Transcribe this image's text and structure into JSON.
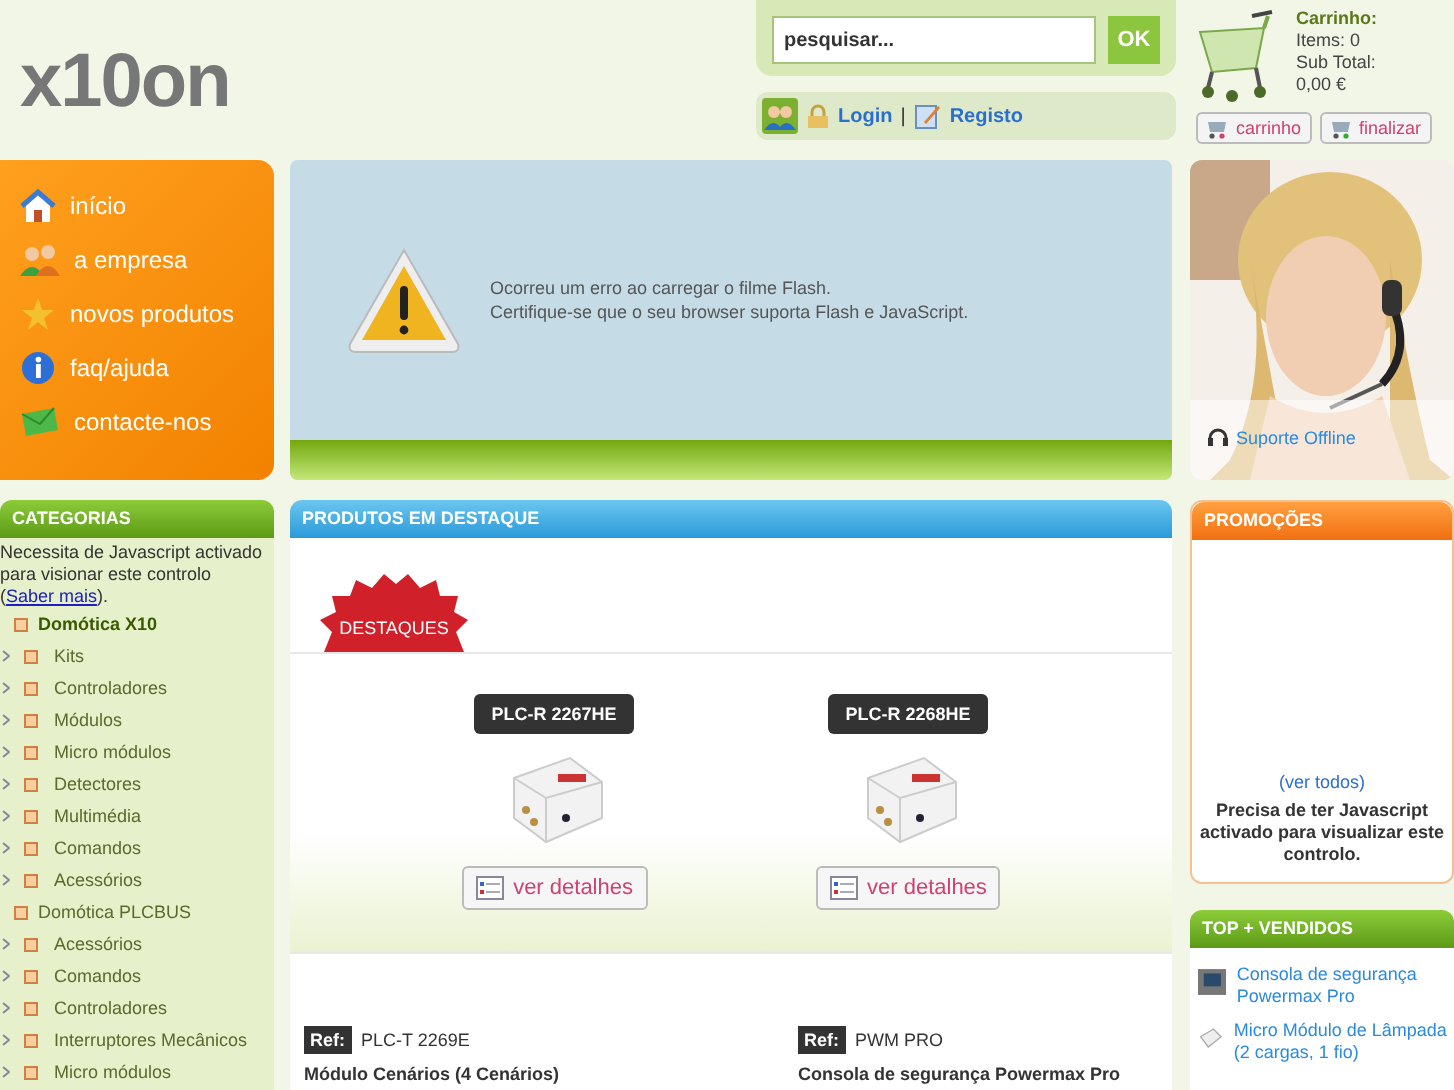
{
  "logo": "x10on",
  "search": {
    "placeholder": "pesquisar...",
    "button": "OK"
  },
  "account": {
    "login": "Login",
    "separator": "|",
    "register": "Registo"
  },
  "cart": {
    "title": "Carrinho:",
    "items": "Items: 0",
    "subtotal_label": "Sub Total:",
    "subtotal": "0,00 €",
    "buttons": [
      "carrinho",
      "finalizar"
    ]
  },
  "menu": [
    {
      "label": "início"
    },
    {
      "label": "a empresa"
    },
    {
      "label": "novos produtos"
    },
    {
      "label": "faq/ajuda"
    },
    {
      "label": "contacte-nos"
    }
  ],
  "flash_error": [
    "Ocorreu um erro ao carregar o filme Flash.",
    "Certifique-se que o seu browser suporta Flash e JavaScript."
  ],
  "support": {
    "label": "Suporte Offline"
  },
  "categories": {
    "title": "CATEGORIAS",
    "notice": "Necessita de Javascript activado para visionar este controlo (",
    "notice_link": "Saber mais",
    "notice_end": ").",
    "items": [
      {
        "label": "Domótica X10",
        "expanded": true,
        "children": [
          {
            "label": "Kits"
          },
          {
            "label": "Controladores"
          },
          {
            "label": "Módulos"
          },
          {
            "label": "Micro módulos"
          },
          {
            "label": "Detectores"
          },
          {
            "label": "Multimédia"
          },
          {
            "label": "Comandos"
          },
          {
            "label": "Acessórios"
          }
        ]
      },
      {
        "label": "Domótica PLCBUS",
        "expanded": false,
        "children": [
          {
            "label": "Acessórios"
          },
          {
            "label": "Comandos"
          },
          {
            "label": "Controladores"
          },
          {
            "label": "Interruptores Mecânicos"
          },
          {
            "label": "Micro módulos"
          }
        ]
      }
    ]
  },
  "featured": {
    "title": "PRODUTOS EM DESTAQUE",
    "badge": "DESTAQUES",
    "products": [
      {
        "name": "PLC-R 2267HE",
        "button": "ver detalhes"
      },
      {
        "name": "PLC-R 2268HE",
        "button": "ver detalhes"
      }
    ],
    "list": [
      {
        "ref_label": "Ref:",
        "ref": "PLC-T 2269E",
        "name": "Módulo Cenários (4 Cenários)"
      },
      {
        "ref_label": "Ref:",
        "ref": "PWM PRO",
        "name": "Consola de segurança Powermax Pro"
      }
    ]
  },
  "promotions": {
    "title": "PROMOÇÕES",
    "link": "(ver todos)",
    "notice": "Precisa de ter Javascript activado para visualizar este controlo."
  },
  "top_sellers": {
    "title": "TOP + VENDIDOS",
    "items": [
      {
        "label": "Consola de segurança Powermax Pro"
      },
      {
        "label": "Micro Módulo de Lâmpada (2 cargas, 1 fio)"
      }
    ]
  }
}
